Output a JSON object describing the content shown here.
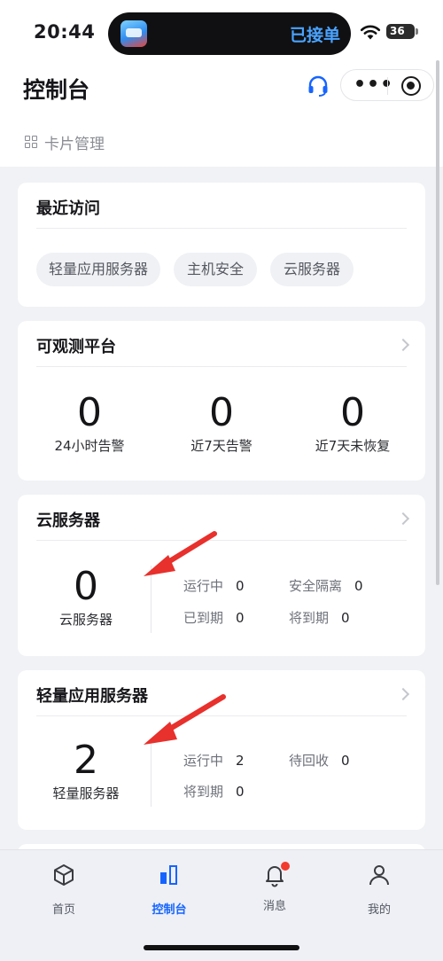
{
  "status_bar": {
    "time": "20:44",
    "island_text": "已接单",
    "battery": "36"
  },
  "header": {
    "title": "控制台",
    "card_management": "卡片管理",
    "menu_dots": "•••"
  },
  "recent": {
    "title": "最近访问",
    "chips": [
      "轻量应用服务器",
      "主机安全",
      "云服务器"
    ]
  },
  "observability": {
    "title": "可观测平台",
    "stats": [
      {
        "value": "0",
        "label": "24小时告警"
      },
      {
        "value": "0",
        "label": "近7天告警"
      },
      {
        "value": "0",
        "label": "近7天未恢复"
      }
    ]
  },
  "cloud_server": {
    "title": "云服务器",
    "count": "0",
    "count_label": "云服务器",
    "details": [
      {
        "label": "运行中",
        "value": "0"
      },
      {
        "label": "安全隔离",
        "value": "0"
      },
      {
        "label": "已到期",
        "value": "0"
      },
      {
        "label": "将到期",
        "value": "0"
      }
    ]
  },
  "light_server": {
    "title": "轻量应用服务器",
    "count": "2",
    "count_label": "轻量服务器",
    "details": [
      {
        "label": "运行中",
        "value": "2"
      },
      {
        "label": "待回收",
        "value": "0"
      },
      {
        "label": "将到期",
        "value": "0"
      }
    ]
  },
  "tabbar": {
    "items": [
      {
        "label": "首页",
        "icon": "cube-icon"
      },
      {
        "label": "控制台",
        "icon": "console-icon"
      },
      {
        "label": "消息",
        "icon": "bell-icon"
      },
      {
        "label": "我的",
        "icon": "person-icon"
      }
    ],
    "active_color": "#1664ff"
  },
  "colors": {
    "accent": "#1664ff",
    "arrow": "#e8302c",
    "background": "#f1f2f5"
  }
}
